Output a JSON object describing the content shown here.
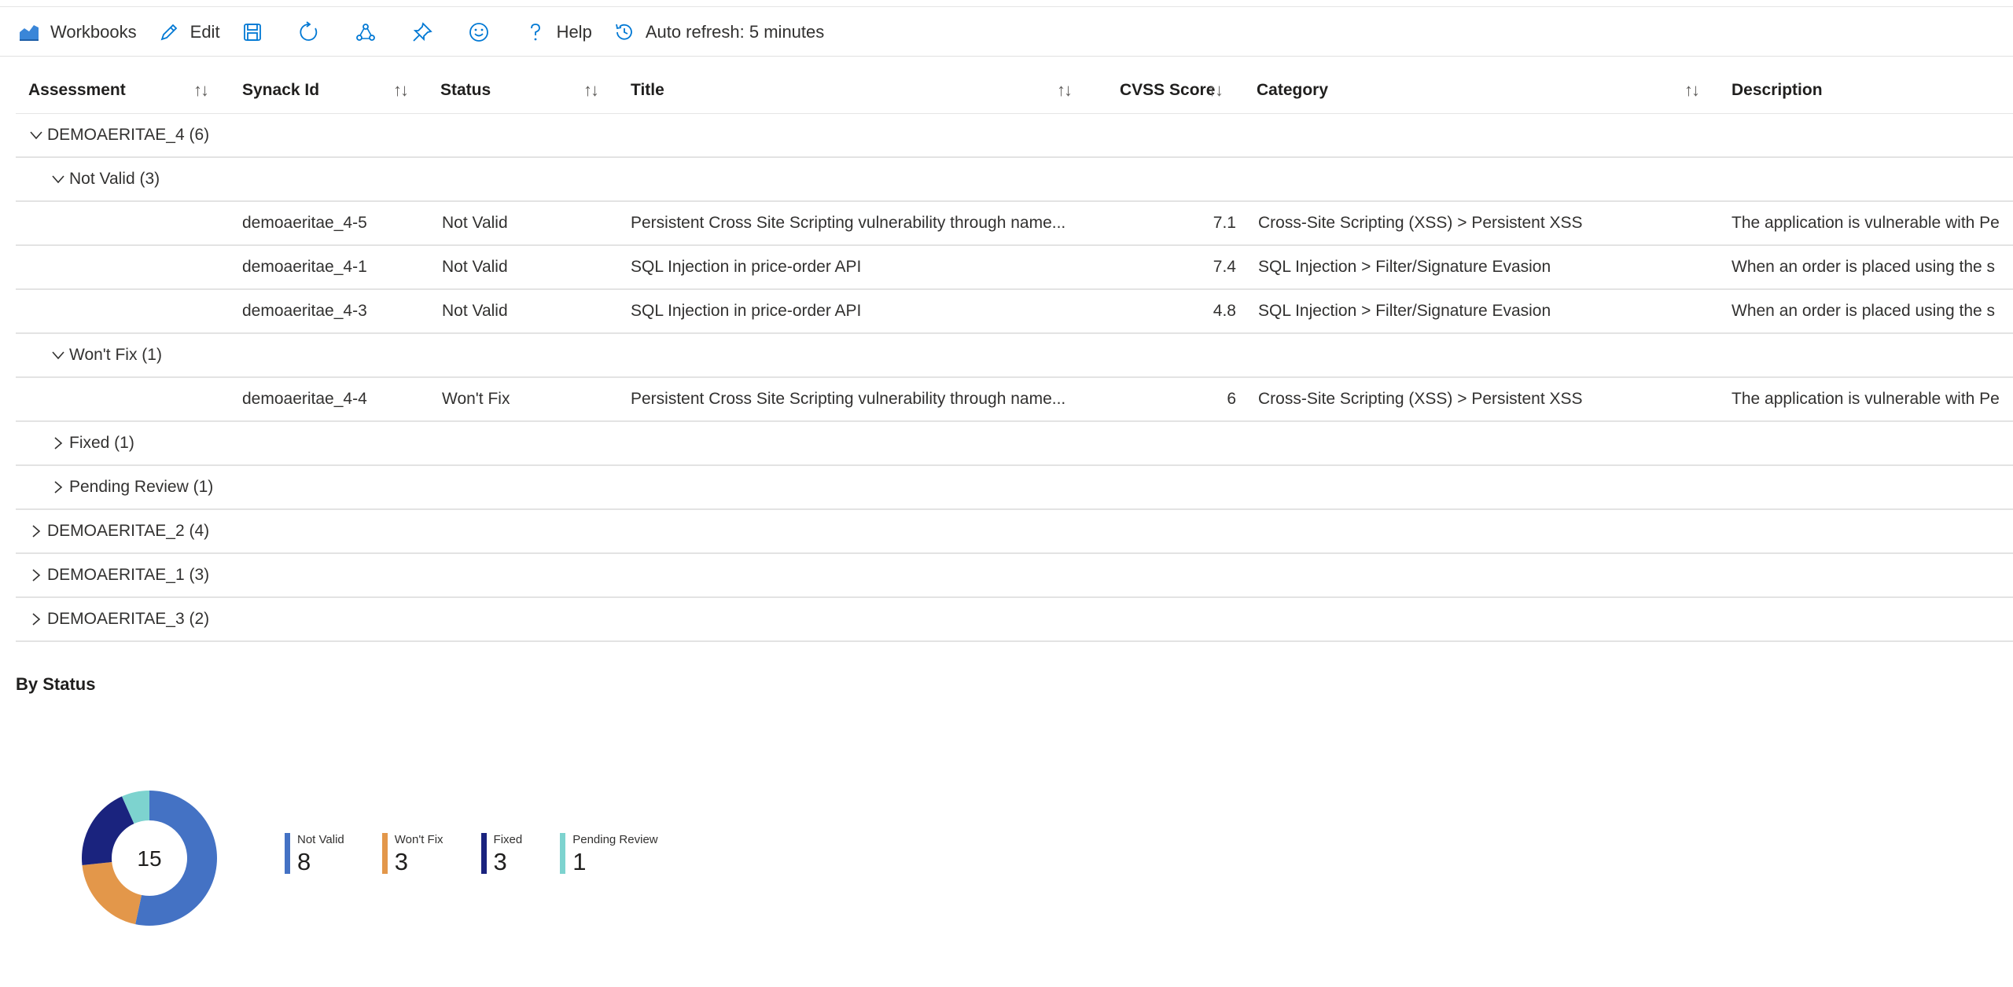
{
  "toolbar": {
    "workbooks_label": "Workbooks",
    "edit_label": "Edit",
    "help_label": "Help",
    "auto_refresh_label": "Auto refresh: 5 minutes",
    "accent": "#0078d4"
  },
  "table": {
    "headers": {
      "assessment": "Assessment",
      "synack_id": "Synack Id",
      "status": "Status",
      "title": "Title",
      "cvss": "CVSS Score",
      "category": "Category",
      "description": "Description"
    },
    "sort_icon": "↑↓",
    "groups": [
      {
        "label": "DEMOAERITAE_4 (6)",
        "expanded": true,
        "subgroups": [
          {
            "label": "Not Valid (3)",
            "expanded": true,
            "rows": [
              {
                "synack_id": "demoaeritae_4-5",
                "status": "Not Valid",
                "title": "Persistent Cross Site Scripting vulnerability through name...",
                "cvss": "7.1",
                "category": "Cross-Site Scripting (XSS) > Persistent XSS",
                "description": "The application is vulnerable with Pe"
              },
              {
                "synack_id": "demoaeritae_4-1",
                "status": "Not Valid",
                "title": "SQL Injection in price-order API",
                "cvss": "7.4",
                "category": "SQL Injection > Filter/Signature Evasion",
                "description": "When an order is placed using the s"
              },
              {
                "synack_id": "demoaeritae_4-3",
                "status": "Not Valid",
                "title": "SQL Injection in price-order API",
                "cvss": "4.8",
                "category": "SQL Injection > Filter/Signature Evasion",
                "description": "When an order is placed using the s"
              }
            ]
          },
          {
            "label": "Won't Fix (1)",
            "expanded": true,
            "rows": [
              {
                "synack_id": "demoaeritae_4-4",
                "status": "Won't Fix",
                "title": "Persistent Cross Site Scripting vulnerability through name...",
                "cvss": "6",
                "category": "Cross-Site Scripting (XSS) > Persistent XSS",
                "description": "The application is vulnerable with Pe"
              }
            ]
          },
          {
            "label": "Fixed (1)",
            "expanded": false,
            "rows": []
          },
          {
            "label": "Pending Review (1)",
            "expanded": false,
            "rows": []
          }
        ]
      },
      {
        "label": "DEMOAERITAE_2 (4)",
        "expanded": false,
        "subgroups": []
      },
      {
        "label": "DEMOAERITAE_1 (3)",
        "expanded": false,
        "subgroups": []
      },
      {
        "label": "DEMOAERITAE_3 (2)",
        "expanded": false,
        "subgroups": []
      }
    ]
  },
  "by_status": {
    "title": "By Status",
    "total": "15",
    "items": [
      {
        "label": "Not Valid",
        "value": 8,
        "color": "#4472c4"
      },
      {
        "label": "Won't Fix",
        "value": 3,
        "color": "#e3974a"
      },
      {
        "label": "Fixed",
        "value": 3,
        "color": "#1a237e"
      },
      {
        "label": "Pending Review",
        "value": 1,
        "color": "#7dd3cf"
      }
    ]
  }
}
